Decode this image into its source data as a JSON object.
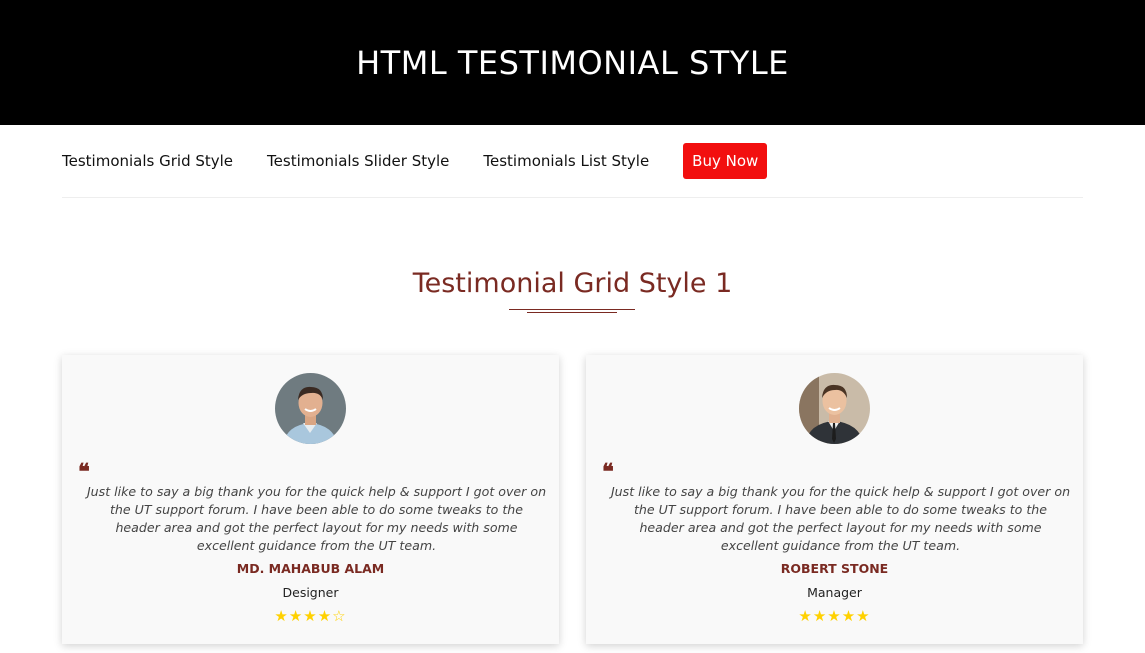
{
  "hero": {
    "title": "HTML TESTIMONIAL STYLE"
  },
  "nav": {
    "items": [
      {
        "label": "Testimonials Grid Style"
      },
      {
        "label": "Testimonials Slider Style"
      },
      {
        "label": "Testimonials List Style"
      }
    ],
    "buy_label": "Buy Now"
  },
  "section": {
    "title": "Testimonial Grid Style 1"
  },
  "testimonials": [
    {
      "quote": "Just like to say a big thank you for the quick help & support I got over on the UT support forum. I have been able to do some tweaks to the header area and got the perfect layout for my needs with some excellent guidance from the UT team.",
      "name": "MD. MAHABUB ALAM",
      "role": "Designer",
      "rating": 4,
      "rating_max": 5,
      "stars": "★★★★☆"
    },
    {
      "quote": "Just like to say a big thank you for the quick help & support I got over on the UT support forum. I have been able to do some tweaks to the header area and got the perfect layout for my needs with some excellent guidance from the UT team.",
      "name": "ROBERT STONE",
      "role": "Manager",
      "rating": 5,
      "rating_max": 5,
      "stars": "★★★★★"
    }
  ],
  "colors": {
    "accent": "#7a2a22",
    "buy_button": "#f20f0f",
    "star": "#ffd100",
    "hero_bg": "#000000"
  },
  "icons": {
    "quote": "quote-icon",
    "star": "star-icon"
  }
}
